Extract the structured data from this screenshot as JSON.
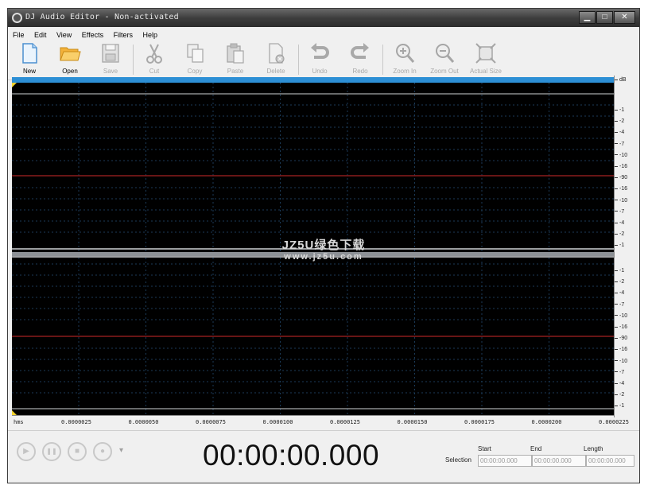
{
  "window": {
    "title": "DJ Audio Editor - Non-activated",
    "controls": {
      "minimize": "▁",
      "maximize": "□",
      "close": "✕"
    }
  },
  "menu": [
    "File",
    "Edit",
    "View",
    "Effects",
    "Filters",
    "Help"
  ],
  "toolbar": [
    {
      "id": "new",
      "label": "New",
      "icon": "new-file-icon",
      "enabled": true
    },
    {
      "id": "open",
      "label": "Open",
      "icon": "folder-open-icon",
      "enabled": true
    },
    {
      "id": "save",
      "label": "Save",
      "icon": "save-disk-icon",
      "enabled": false
    },
    {
      "id": "cut",
      "label": "Cut",
      "icon": "scissors-icon",
      "enabled": false
    },
    {
      "id": "copy",
      "label": "Copy",
      "icon": "copy-icon",
      "enabled": false
    },
    {
      "id": "paste",
      "label": "Paste",
      "icon": "paste-icon",
      "enabled": false
    },
    {
      "id": "delete",
      "label": "Delete",
      "icon": "delete-icon",
      "enabled": false
    },
    {
      "id": "undo",
      "label": "Undo",
      "icon": "undo-icon",
      "enabled": false
    },
    {
      "id": "redo",
      "label": "Redo",
      "icon": "redo-icon",
      "enabled": false
    },
    {
      "id": "zoomin",
      "label": "Zoom In",
      "icon": "zoom-in-icon",
      "enabled": false
    },
    {
      "id": "zoomout",
      "label": "Zoom Out",
      "icon": "zoom-out-icon",
      "enabled": false
    },
    {
      "id": "actualsize",
      "label": "Actual Size",
      "icon": "actual-size-icon",
      "enabled": false
    }
  ],
  "db_scale": {
    "unit": "dB",
    "upper": [
      "-1",
      "-2",
      "-4",
      "-7",
      "-10",
      "-16",
      "-90",
      "-16",
      "-10",
      "-7",
      "-4",
      "-2",
      "-1"
    ],
    "lower": [
      "-1",
      "-2",
      "-4",
      "-7",
      "-10",
      "-16",
      "-90",
      "-16",
      "-10",
      "-7",
      "-4",
      "-2",
      "-1"
    ]
  },
  "timeline": {
    "start": "hms",
    "ticks": [
      "0.0000025",
      "0.0000050",
      "0.0000075",
      "0.0000100",
      "0.0000125",
      "0.0000150",
      "0.0000175",
      "0.0000200",
      "0.0000225"
    ]
  },
  "transport": {
    "timecode": "00:00:00.000",
    "buttons": [
      {
        "id": "play",
        "glyph": "▶",
        "icon": "play-icon"
      },
      {
        "id": "pause",
        "glyph": "❚❚",
        "icon": "pause-icon"
      },
      {
        "id": "stop",
        "glyph": "■",
        "icon": "stop-icon"
      },
      {
        "id": "record",
        "glyph": "●",
        "icon": "record-icon"
      }
    ],
    "dropdown_glyph": "▾"
  },
  "selection": {
    "label": "Selection",
    "start_label": "Start",
    "end_label": "End",
    "length_label": "Length",
    "start_value": "00:00:00.000",
    "end_value": "00:00:00.000",
    "length_value": "00:00:00.000"
  },
  "watermark": {
    "line1": "JZ5U绿色下载",
    "line2": "www.jz5u.com"
  },
  "colors": {
    "band": "#2d8fd5",
    "waveform_bg": "#000000",
    "grid": "#1b3a57",
    "center_red": "#8a1c1c",
    "channel_line": "#cfd3d6"
  }
}
